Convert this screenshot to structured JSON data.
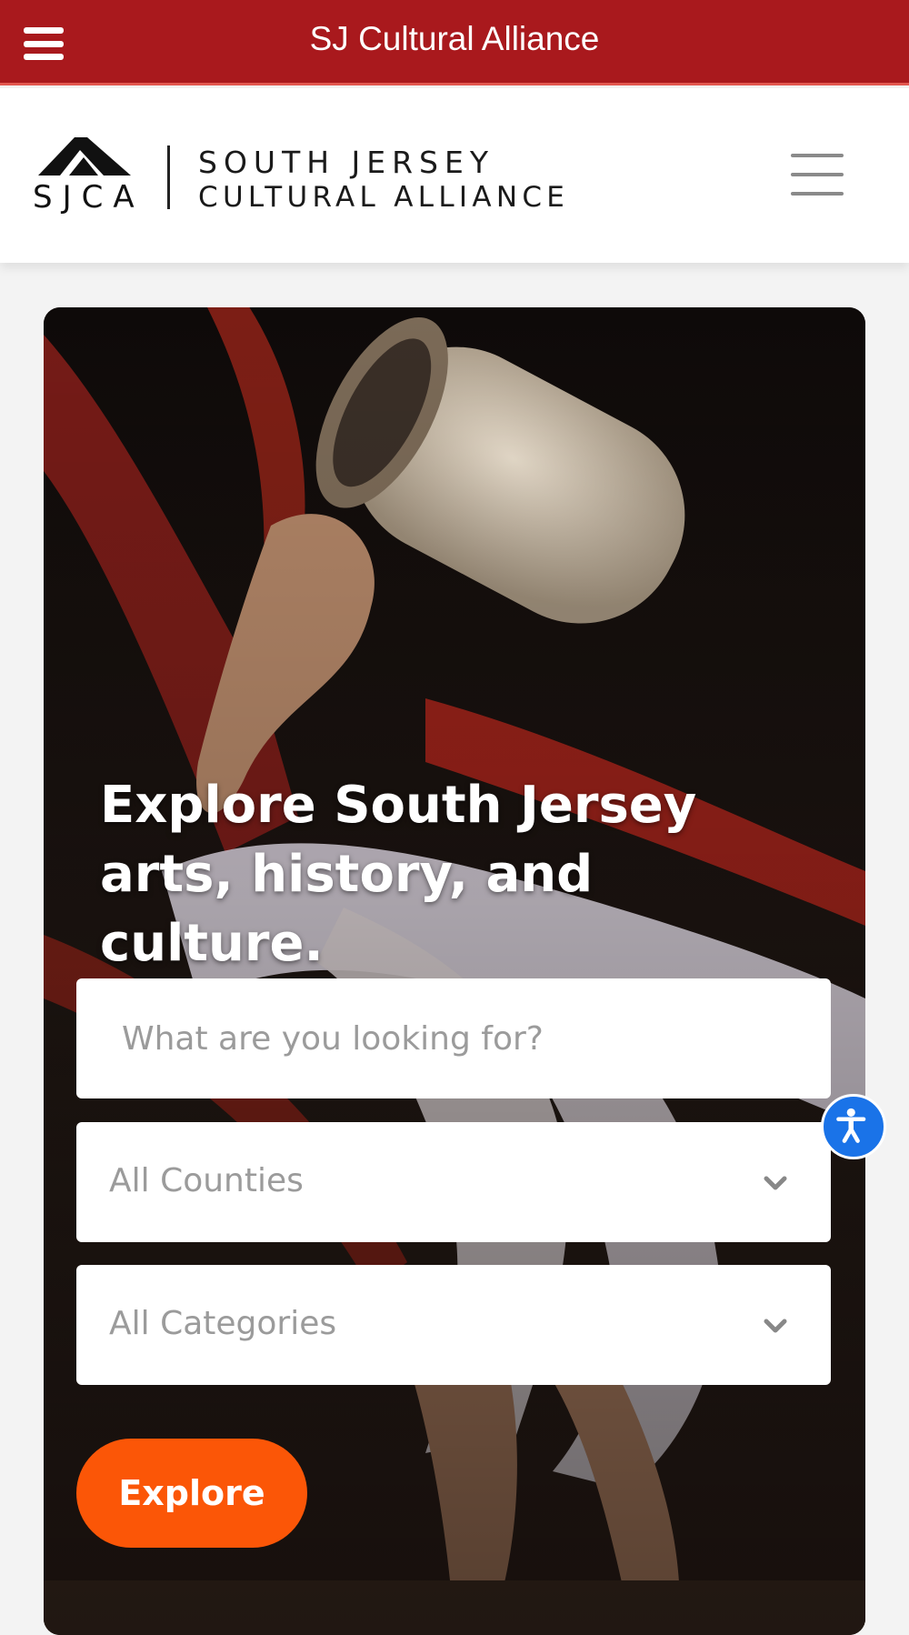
{
  "topbar": {
    "title": "SJ Cultural Alliance",
    "menu_icon": "hamburger-icon"
  },
  "header": {
    "logo_mark_text": "SJCA",
    "logo_line1": "SOUTH JERSEY",
    "logo_line2": "CULTURAL ALLIANCE",
    "menu_icon": "hamburger-icon"
  },
  "hero": {
    "headline": "Explore South Jersey arts, history, and culture.",
    "search_placeholder": "What are you looking for?",
    "county_select": "All Counties",
    "category_select": "All Categories",
    "explore_label": "Explore"
  },
  "accessibility": {
    "icon": "accessibility-icon"
  },
  "colors": {
    "topbar": "#a9191d",
    "explore_button": "#fb5607",
    "accessibility": "#1a73e8"
  }
}
